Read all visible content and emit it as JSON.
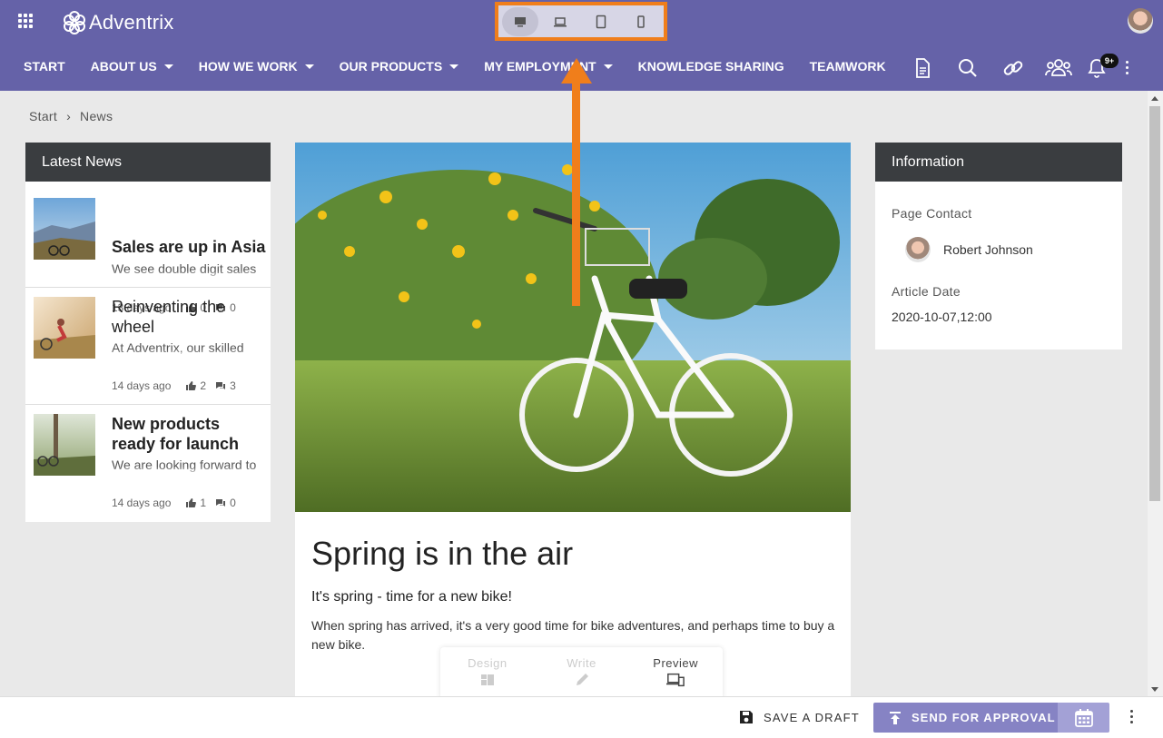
{
  "app": {
    "name": "Adventrix"
  },
  "nav": {
    "items": [
      {
        "label": "START",
        "has_caret": false
      },
      {
        "label": "ABOUT US",
        "has_caret": true
      },
      {
        "label": "HOW WE WORK",
        "has_caret": true
      },
      {
        "label": "OUR PRODUCTS",
        "has_caret": true
      },
      {
        "label": "MY EMPLOYMENT",
        "has_caret": true
      },
      {
        "label": "KNOWLEDGE SHARING",
        "has_caret": false
      },
      {
        "label": "TEAMWORK",
        "has_caret": false
      }
    ],
    "notification_badge": "9+"
  },
  "device_switcher": {
    "devices": [
      "desktop-icon",
      "laptop-icon",
      "tablet-icon",
      "phone-icon"
    ],
    "active": "desktop-icon",
    "highlight_color": "#f07e1b"
  },
  "breadcrumb": {
    "items": [
      "Start",
      "News"
    ],
    "separator": "›"
  },
  "latest_news": {
    "title": "Latest News",
    "items": [
      {
        "title": "Sales are up in Asia",
        "excerpt": "We see double digit sales rise in Japan and",
        "age": "13 days ago",
        "likes": "0",
        "comments": "0",
        "bold": true
      },
      {
        "title": "Reinventing the wheel",
        "excerpt": "At Adventrix, our skilled and service-minded",
        "age": "14 days ago",
        "likes": "2",
        "comments": "3",
        "bold": false
      },
      {
        "title": "New products ready for launch",
        "excerpt": "We are looking forward to seeing the new MTB",
        "age": "14 days ago",
        "likes": "1",
        "comments": "0",
        "bold": true
      }
    ]
  },
  "article": {
    "title": "Spring is in the air",
    "lead": "It's spring - time for a new bike!",
    "body": "When spring has arrived, it's a very good time for bike adventures, and perhaps time to buy a new bike."
  },
  "mode_switch": {
    "design": "Design",
    "write": "Write",
    "preview": "Preview",
    "active": "preview"
  },
  "information": {
    "title": "Information",
    "contact_label": "Page Contact",
    "contact_name": "Robert Johnson",
    "date_label": "Article Date",
    "date_value": "2020-10-07,12:00"
  },
  "actions": {
    "save_draft": "SAVE A DRAFT",
    "send_for_approval": "SEND FOR APPROVAL"
  },
  "colors": {
    "header": "#6562a8",
    "accent_button": "#8683c4",
    "panel_header": "#3a3d40",
    "annotation": "#f07e1b"
  }
}
